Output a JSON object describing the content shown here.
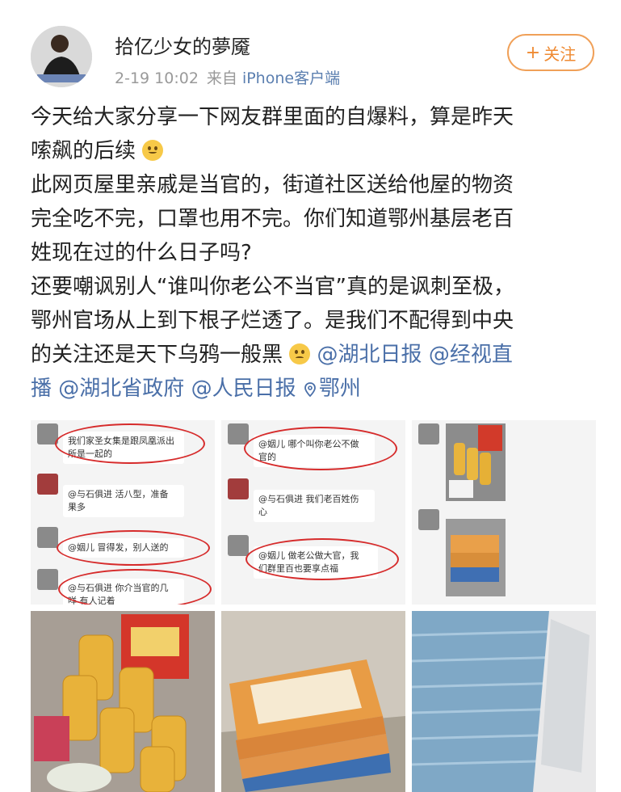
{
  "post": {
    "author": {
      "name": "拾亿少女的夢魇"
    },
    "meta": {
      "time": "2-19 10:02",
      "from_prefix": "来自",
      "client": "iPhone客户端"
    },
    "follow": {
      "plus": "+",
      "label": "关注"
    },
    "text": {
      "p1_line1": "今天给大家分享一下网友群里面的自爆料，算是昨天",
      "p1_line2": "嗦飙的后续",
      "p2_line1": "此网页屋里亲戚是当官的，街道社区送给他屋的物资",
      "p2_line2": "完全吃不完，口罩也用不完。你们知道鄂州基层老百",
      "p2_line3": "姓现在过的什么日子吗?",
      "p3_line1": "还要嘲讽别人“谁叫你老公不当官”真的是讽刺至极，",
      "p3_line2": "鄂州官场从上到下根子烂透了。是我们不配得到中央",
      "p3_line3": "的关注还是天下乌鸦一般黑",
      "mention1": "@湖北日报",
      "mention2": "@经视直",
      "mention2b": "播",
      "mention3": "@湖北省政府",
      "mention4": "@人民日报",
      "location": "鄂州"
    }
  },
  "images": {
    "chat1": {
      "m1": "我们家圣女集是跟凤凰派出所是一起的",
      "m2": "@与石俱进 活八型，准备",
      "m2b": "果多",
      "m3": "@姻儿 冒得发，别人送的",
      "m4": "@与石俱进 你介当官的几",
      "m4b": "咩 有人记着"
    },
    "chat2": {
      "m1": "@姻儿 哪个叫你老公不做",
      "m1b": "官的",
      "m2": "@与石俱进 我们老百姓伤",
      "m2b": "心",
      "m3": "@姻儿 做老公做大官，我",
      "m3b": "们群里百也要享点福"
    }
  },
  "colors": {
    "link": "#4a6fa8",
    "follow": "#ef8a32",
    "annotation": "#d62b2b"
  },
  "icons": {
    "location": "location-pin-icon",
    "emoji1": "smirk-emoji-icon",
    "emoji2": "sad-emoji-icon"
  }
}
